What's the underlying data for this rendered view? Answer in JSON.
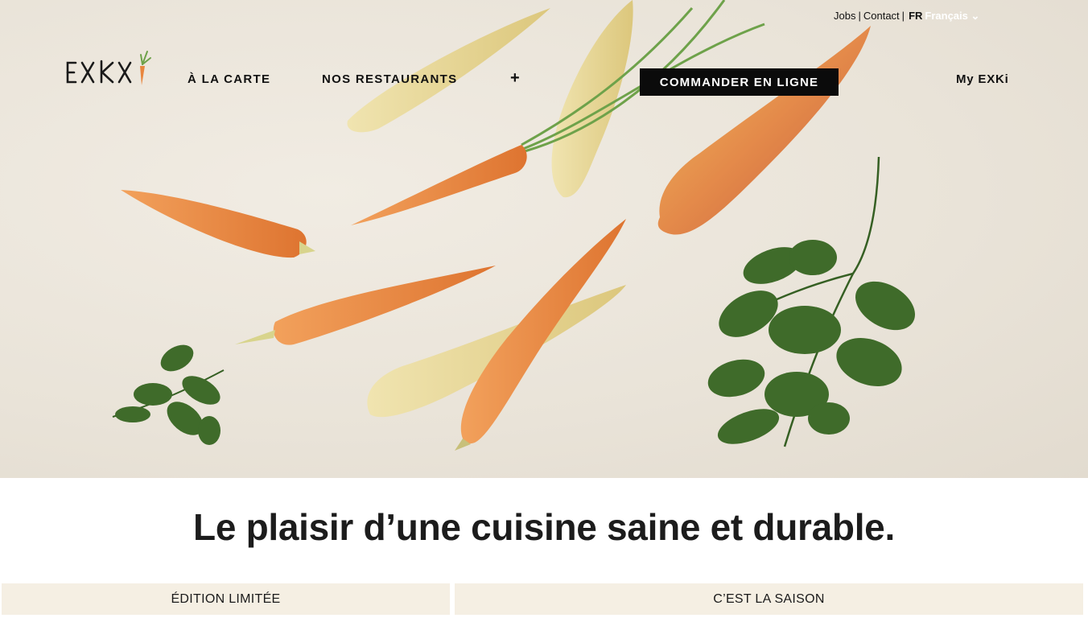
{
  "utility": {
    "jobs": "Jobs",
    "separator": "|",
    "contact": "Contact",
    "lang_code": "FR",
    "lang_name": "Français",
    "lang_caret": "⌄"
  },
  "brand": {
    "name": "EXKi"
  },
  "nav": {
    "carte": "À LA CARTE",
    "restaurants": "NOS RESTAURANTS",
    "plus": "+",
    "order": "COMMANDER EN LIGNE",
    "my_account": "My EXKi"
  },
  "hero": {
    "tagline": "Le plaisir d’une cuisine saine et durable."
  },
  "tabs": [
    {
      "label": "ÉDITION LIMITÉE"
    },
    {
      "label": "C’EST LA SAISON"
    }
  ],
  "colors": {
    "carrot_orange": "#e8863e",
    "carrot_yellow": "#e7d79a",
    "leaf_green": "#3f6b2a",
    "tab_bg": "#f5efe3",
    "button_bg": "#0b0b0b"
  }
}
